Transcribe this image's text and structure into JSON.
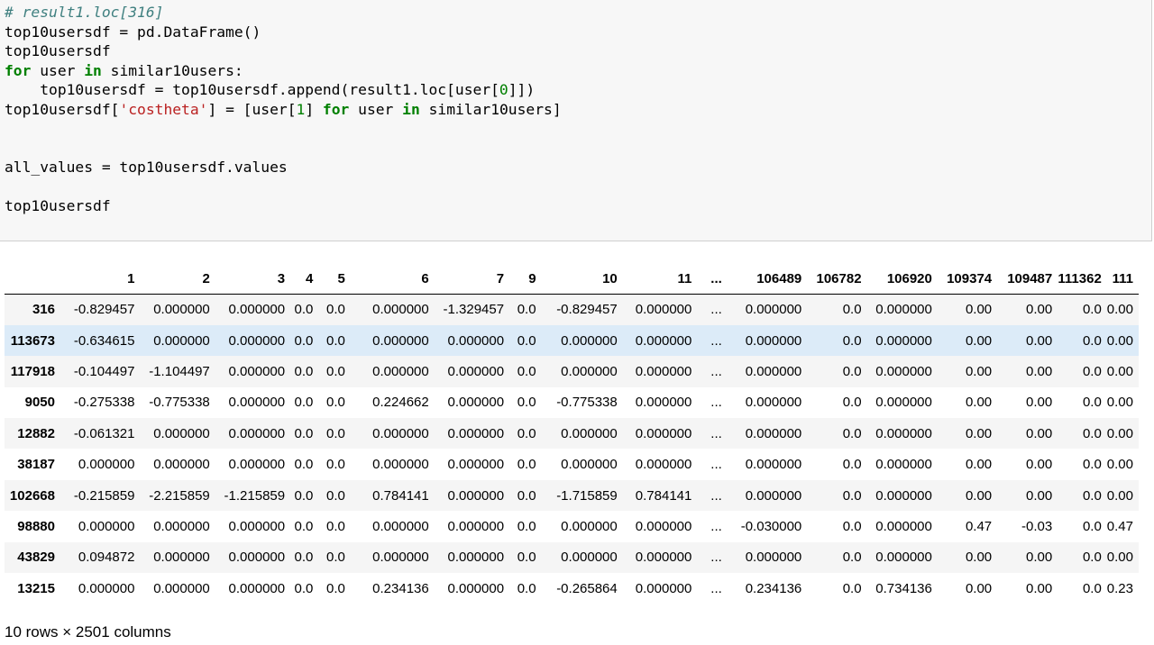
{
  "code": {
    "line1_comment": "# result1.loc[316]",
    "line2": "top10usersdf = pd.DataFrame()",
    "line3": "top10usersdf",
    "line4_kw_for": "for",
    "line4_a": " user ",
    "line4_kw_in": "in",
    "line4_b": " similar10users:",
    "line5_a": "    top10usersdf = top10usersdf.append(result1.loc[user[",
    "line5_num": "0",
    "line5_b": "]])",
    "line6_a": "top10usersdf[",
    "line6_str": "'costheta'",
    "line6_b": "] = [user[",
    "line6_num": "1",
    "line6_c": "] ",
    "line6_kw_for": "for",
    "line6_d": " user ",
    "line6_kw_in": "in",
    "line6_e": " similar10users]",
    "line9": "all_values = top10usersdf.values",
    "line11": "top10usersdf"
  },
  "table": {
    "columns": [
      "1",
      "2",
      "3",
      "4",
      "5",
      "6",
      "7",
      "9",
      "10",
      "11",
      "...",
      "106489",
      "106782",
      "106920",
      "109374",
      "109487",
      "111362",
      "111"
    ],
    "rows": [
      {
        "index": "316",
        "cells": [
          "-0.829457",
          "0.000000",
          "0.000000",
          "0.0",
          "0.0",
          "0.000000",
          "-1.329457",
          "0.0",
          "-0.829457",
          "0.000000",
          "...",
          "0.000000",
          "0.0",
          "0.000000",
          "0.00",
          "0.00",
          "0.0",
          "0.00"
        ]
      },
      {
        "index": "113673",
        "cells": [
          "-0.634615",
          "0.000000",
          "0.000000",
          "0.0",
          "0.0",
          "0.000000",
          "0.000000",
          "0.0",
          "0.000000",
          "0.000000",
          "...",
          "0.000000",
          "0.0",
          "0.000000",
          "0.00",
          "0.00",
          "0.0",
          "0.00"
        ]
      },
      {
        "index": "117918",
        "cells": [
          "-0.104497",
          "-1.104497",
          "0.000000",
          "0.0",
          "0.0",
          "0.000000",
          "0.000000",
          "0.0",
          "0.000000",
          "0.000000",
          "...",
          "0.000000",
          "0.0",
          "0.000000",
          "0.00",
          "0.00",
          "0.0",
          "0.00"
        ]
      },
      {
        "index": "9050",
        "cells": [
          "-0.275338",
          "-0.775338",
          "0.000000",
          "0.0",
          "0.0",
          "0.224662",
          "0.000000",
          "0.0",
          "-0.775338",
          "0.000000",
          "...",
          "0.000000",
          "0.0",
          "0.000000",
          "0.00",
          "0.00",
          "0.0",
          "0.00"
        ]
      },
      {
        "index": "12882",
        "cells": [
          "-0.061321",
          "0.000000",
          "0.000000",
          "0.0",
          "0.0",
          "0.000000",
          "0.000000",
          "0.0",
          "0.000000",
          "0.000000",
          "...",
          "0.000000",
          "0.0",
          "0.000000",
          "0.00",
          "0.00",
          "0.0",
          "0.00"
        ]
      },
      {
        "index": "38187",
        "cells": [
          "0.000000",
          "0.000000",
          "0.000000",
          "0.0",
          "0.0",
          "0.000000",
          "0.000000",
          "0.0",
          "0.000000",
          "0.000000",
          "...",
          "0.000000",
          "0.0",
          "0.000000",
          "0.00",
          "0.00",
          "0.0",
          "0.00"
        ]
      },
      {
        "index": "102668",
        "cells": [
          "-0.215859",
          "-2.215859",
          "-1.215859",
          "0.0",
          "0.0",
          "0.784141",
          "0.000000",
          "0.0",
          "-1.715859",
          "0.784141",
          "...",
          "0.000000",
          "0.0",
          "0.000000",
          "0.00",
          "0.00",
          "0.0",
          "0.00"
        ]
      },
      {
        "index": "98880",
        "cells": [
          "0.000000",
          "0.000000",
          "0.000000",
          "0.0",
          "0.0",
          "0.000000",
          "0.000000",
          "0.0",
          "0.000000",
          "0.000000",
          "...",
          "-0.030000",
          "0.0",
          "0.000000",
          "0.47",
          "-0.03",
          "0.0",
          "0.47"
        ]
      },
      {
        "index": "43829",
        "cells": [
          "0.094872",
          "0.000000",
          "0.000000",
          "0.0",
          "0.0",
          "0.000000",
          "0.000000",
          "0.0",
          "0.000000",
          "0.000000",
          "...",
          "0.000000",
          "0.0",
          "0.000000",
          "0.00",
          "0.00",
          "0.0",
          "0.00"
        ]
      },
      {
        "index": "13215",
        "cells": [
          "0.000000",
          "0.000000",
          "0.000000",
          "0.0",
          "0.0",
          "0.234136",
          "0.000000",
          "0.0",
          "-0.265864",
          "0.000000",
          "...",
          "0.234136",
          "0.0",
          "0.734136",
          "0.00",
          "0.00",
          "0.0",
          "0.23"
        ]
      }
    ],
    "hover_row": 1,
    "footer": "10 rows × 2501 columns"
  }
}
